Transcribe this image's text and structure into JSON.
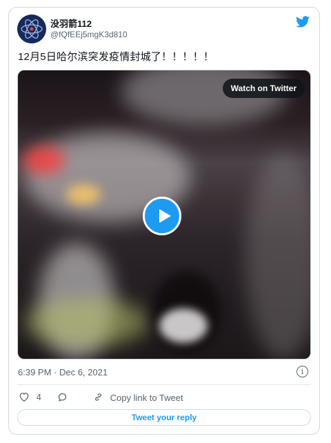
{
  "user": {
    "display_name": "没羽箭112",
    "handle": "@fQfEEj5mgK3d810",
    "avatar_icon": "atom-logo-icon"
  },
  "tweet": {
    "text": "12月5日哈尔滨突发疫情封城了！！！！！"
  },
  "media": {
    "watch_label": "Watch on Twitter",
    "play_icon": "play-icon"
  },
  "meta": {
    "timestamp": "6:39 PM · Dec 6, 2021",
    "info_icon": "info-icon"
  },
  "actions": {
    "like_count": "4",
    "copy_link_label": "Copy link to Tweet",
    "reply_button_label": "Tweet your reply"
  },
  "colors": {
    "accent": "#1d9bf0",
    "secondary_text": "#536471",
    "border": "#cfd9de"
  }
}
